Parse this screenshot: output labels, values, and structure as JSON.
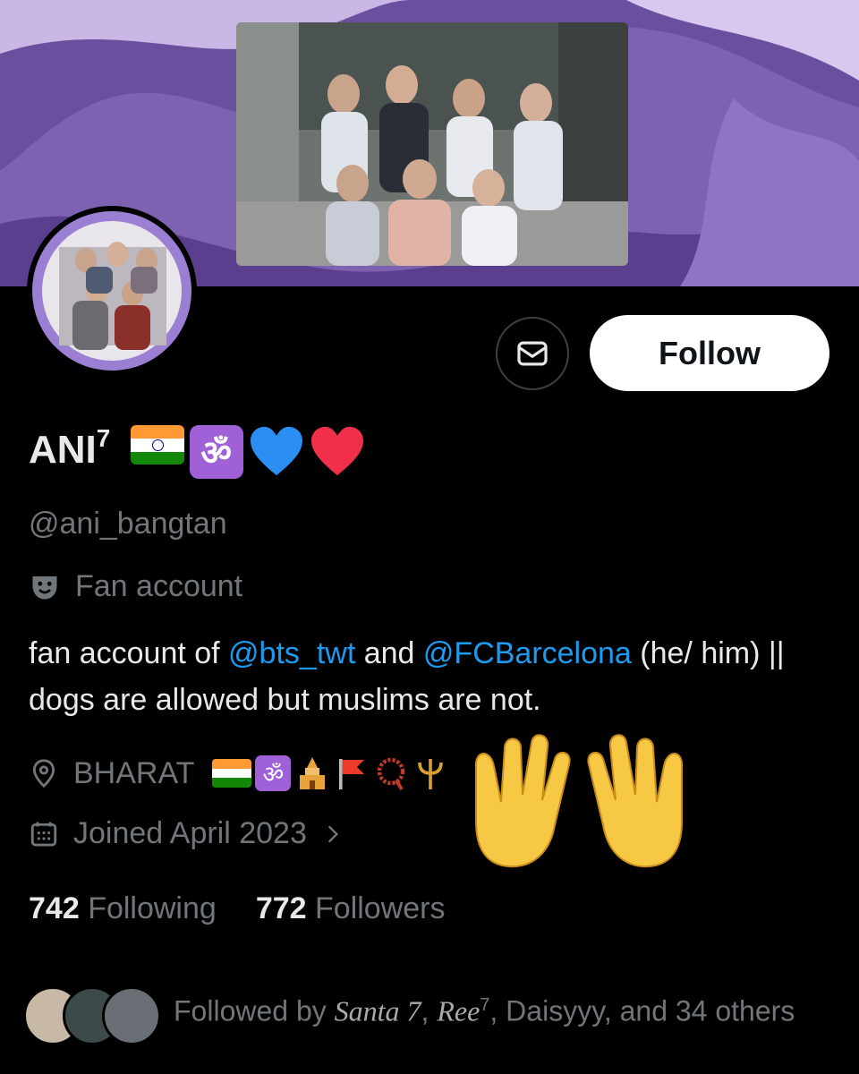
{
  "profile": {
    "name": "ANI",
    "name_superscript": "7",
    "name_emojis": [
      "india-flag",
      "om",
      "blue-heart",
      "red-heart"
    ],
    "handle": "@ani_bangtan",
    "category_icon": "theater-masks-icon",
    "category": "Fan account",
    "bio": {
      "part1": "fan account of ",
      "mention1": "@bts_twt",
      "part2": " and ",
      "mention2": "@FCBarcelona",
      "part3": " (he/ him) || dogs are allowed but muslims are not."
    },
    "location_icon": "location-pin-icon",
    "location": "BHARAT",
    "location_emojis": [
      "india-flag",
      "om",
      "temple",
      "saffron-flag",
      "prayer-beads",
      "trident"
    ],
    "joined_icon": "calendar-icon",
    "joined": "Joined April 2023",
    "following_count": "742",
    "following_label": "Following",
    "followers_count": "772",
    "followers_label": "Followers"
  },
  "actions": {
    "message_icon": "envelope-icon",
    "follow_label": "Follow"
  },
  "followed_by": {
    "prefix": "Followed by ",
    "name1": "Santa 7",
    "sep1": ", ",
    "name2": "Ree",
    "name2_sup": "7",
    "rest": ", Daisyyy, and 34 others"
  },
  "overlay": {
    "emoji": "raised-hands"
  },
  "colors": {
    "accent": "#1d9bf0",
    "banner": "#7e64b0",
    "muted": "#71767b"
  }
}
